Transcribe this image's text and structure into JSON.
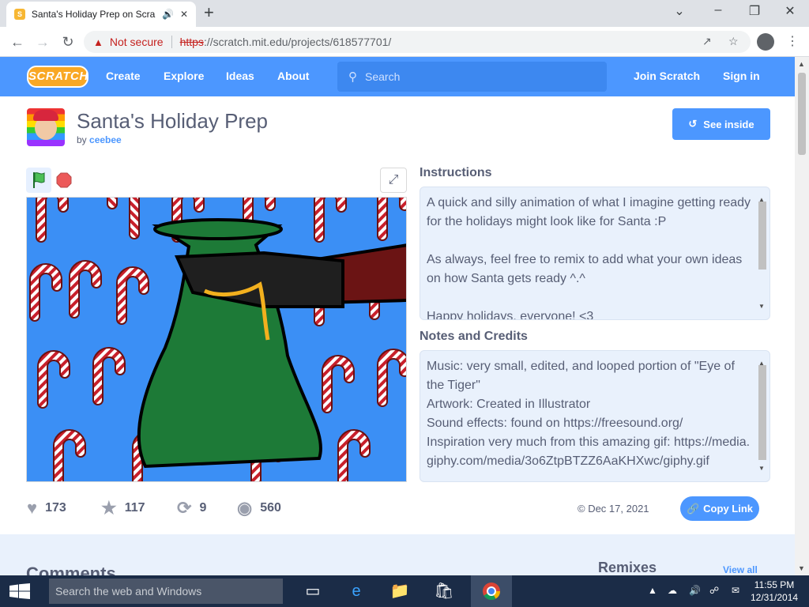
{
  "browser": {
    "tab_title": "Santa's Holiday Prep on Scra",
    "new_tab": "+",
    "not_secure": "Not secure",
    "url_scheme": "https",
    "url_rest": "://scratch.mit.edu/projects/618577701/"
  },
  "nav": {
    "logo": "SCRATCH",
    "links": [
      "Create",
      "Explore",
      "Ideas",
      "About"
    ],
    "search_placeholder": "Search",
    "join": "Join Scratch",
    "signin": "Sign in"
  },
  "project": {
    "title": "Santa's Holiday Prep",
    "by": "by",
    "author": "ceebee",
    "see_inside": "See inside",
    "stats": {
      "loves": "173",
      "favorites": "117",
      "remixes": "9",
      "views": "560"
    },
    "date": "© Dec 17, 2021",
    "copy_link": "Copy Link"
  },
  "instructions": {
    "title": "Instructions",
    "paragraphs": [
      "A quick and silly animation of what I imagine getting ready for the holidays might look like for Santa :P",
      "As always, feel free to remix to add what your own ideas on how Santa gets ready ^.^",
      "Happy holidays, everyone! <3"
    ]
  },
  "notes": {
    "title": "Notes and Credits",
    "lines": [
      "Music: very small, edited, and looped portion of \"Eye of the Tiger\"",
      "Artwork: Created in Illustrator",
      "Sound effects: found on https://freesound.org/",
      "Inspiration very much from this amazing gif: https://media.giphy.com/media/3o6ZtpBTZZ6AaKHXwc/giphy.gif"
    ]
  },
  "lower": {
    "comments": "Comments",
    "remixes": "Remixes",
    "view_all": "View all"
  },
  "taskbar": {
    "search": "Search the web and Windows",
    "time": "11:55 PM",
    "date": "12/31/2014"
  },
  "icons": {
    "tab_favicon": "scratch-cat-icon",
    "audio": "speaker-icon",
    "close": "close-icon"
  },
  "colors": {
    "scratch_blue": "#4c97ff",
    "text": "#575e75"
  }
}
